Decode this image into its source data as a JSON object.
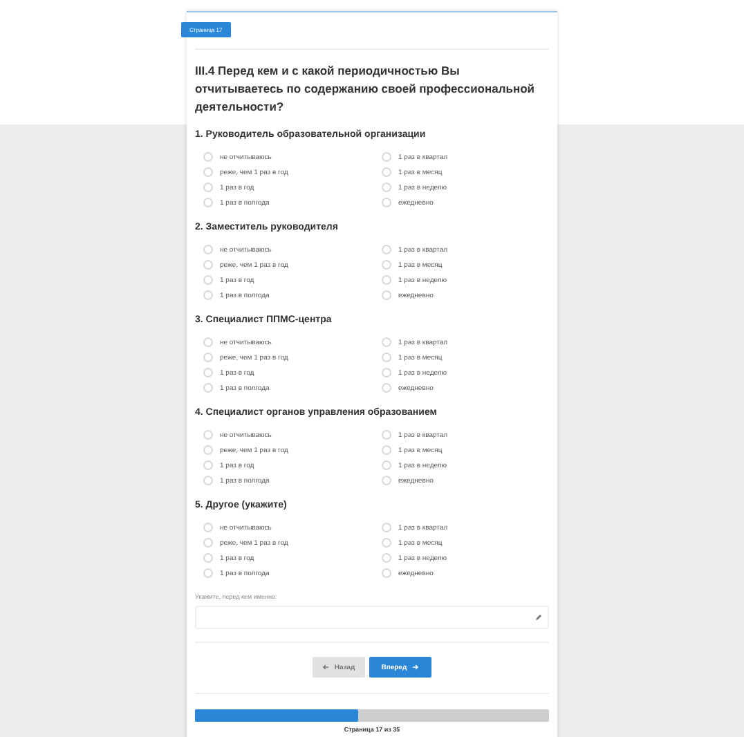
{
  "page_badge": "Страница 17",
  "question": "III.4 Перед кем и с какой периодичностью Вы отчитываетесь по содержанию своей профессиональной деятельности?",
  "sections": [
    {
      "title": "1. Руководитель образовательной организации",
      "options": [
        {
          "label": "не отчитываюсь",
          "selected": false
        },
        {
          "label": "1 раз в квартал",
          "selected": false
        },
        {
          "label": "реже, чем 1 раз в год",
          "selected": false
        },
        {
          "label": "1 раз в месяц",
          "selected": false
        },
        {
          "label": "1 раз в год",
          "selected": false
        },
        {
          "label": "1 раз в неделю",
          "selected": false
        },
        {
          "label": "1 раз в полгода",
          "selected": false
        },
        {
          "label": "ежедневно",
          "selected": false
        }
      ]
    },
    {
      "title": "2. Заместитель руководителя",
      "options": [
        {
          "label": "не отчитываюсь",
          "selected": false
        },
        {
          "label": "1 раз в квартал",
          "selected": false
        },
        {
          "label": "реже, чем 1 раз в год",
          "selected": false
        },
        {
          "label": "1 раз в месяц",
          "selected": false
        },
        {
          "label": "1 раз в год",
          "selected": false
        },
        {
          "label": "1 раз в неделю",
          "selected": false
        },
        {
          "label": "1 раз в полгода",
          "selected": false
        },
        {
          "label": "ежедневно",
          "selected": false
        }
      ]
    },
    {
      "title": "3. Специалист ППМС-центра",
      "options": [
        {
          "label": "не отчитываюсь",
          "selected": false
        },
        {
          "label": "1 раз в квартал",
          "selected": false
        },
        {
          "label": "реже, чем 1 раз в год",
          "selected": false
        },
        {
          "label": "1 раз в месяц",
          "selected": false
        },
        {
          "label": "1 раз в год",
          "selected": false
        },
        {
          "label": "1 раз в неделю",
          "selected": false
        },
        {
          "label": "1 раз в полгода",
          "selected": false
        },
        {
          "label": "ежедневно",
          "selected": false
        }
      ]
    },
    {
      "title": "4. Специалист органов управления образованием",
      "options": [
        {
          "label": "не отчитываюсь",
          "selected": false
        },
        {
          "label": "1 раз в квартал",
          "selected": false
        },
        {
          "label": "реже, чем 1 раз в год",
          "selected": false
        },
        {
          "label": "1 раз в месяц",
          "selected": false
        },
        {
          "label": "1 раз в год",
          "selected": false
        },
        {
          "label": "1 раз в неделю",
          "selected": false
        },
        {
          "label": "1 раз в полгода",
          "selected": false
        },
        {
          "label": "ежедневно",
          "selected": false
        }
      ]
    },
    {
      "title": "5. Другое (укажите)",
      "options": [
        {
          "label": "не отчитываюсь",
          "selected": false
        },
        {
          "label": "1 раз в квартал",
          "selected": false
        },
        {
          "label": "реже, чем 1 раз в год",
          "selected": false
        },
        {
          "label": "1 раз в месяц",
          "selected": false
        },
        {
          "label": "1 раз в год",
          "selected": false
        },
        {
          "label": "1 раз в неделю",
          "selected": false
        },
        {
          "label": "1 раз в полгода",
          "selected": false
        },
        {
          "label": "ежедневно",
          "selected": false
        }
      ]
    }
  ],
  "other_field": {
    "label": "Укажите, перед кем именно:"
  },
  "buttons": [
    {
      "kind": "back",
      "label": "Назад"
    },
    {
      "kind": "next",
      "label": "Вперед"
    }
  ],
  "progress": {
    "level": 0.46,
    "caption": "Страница 17 из 35"
  }
}
